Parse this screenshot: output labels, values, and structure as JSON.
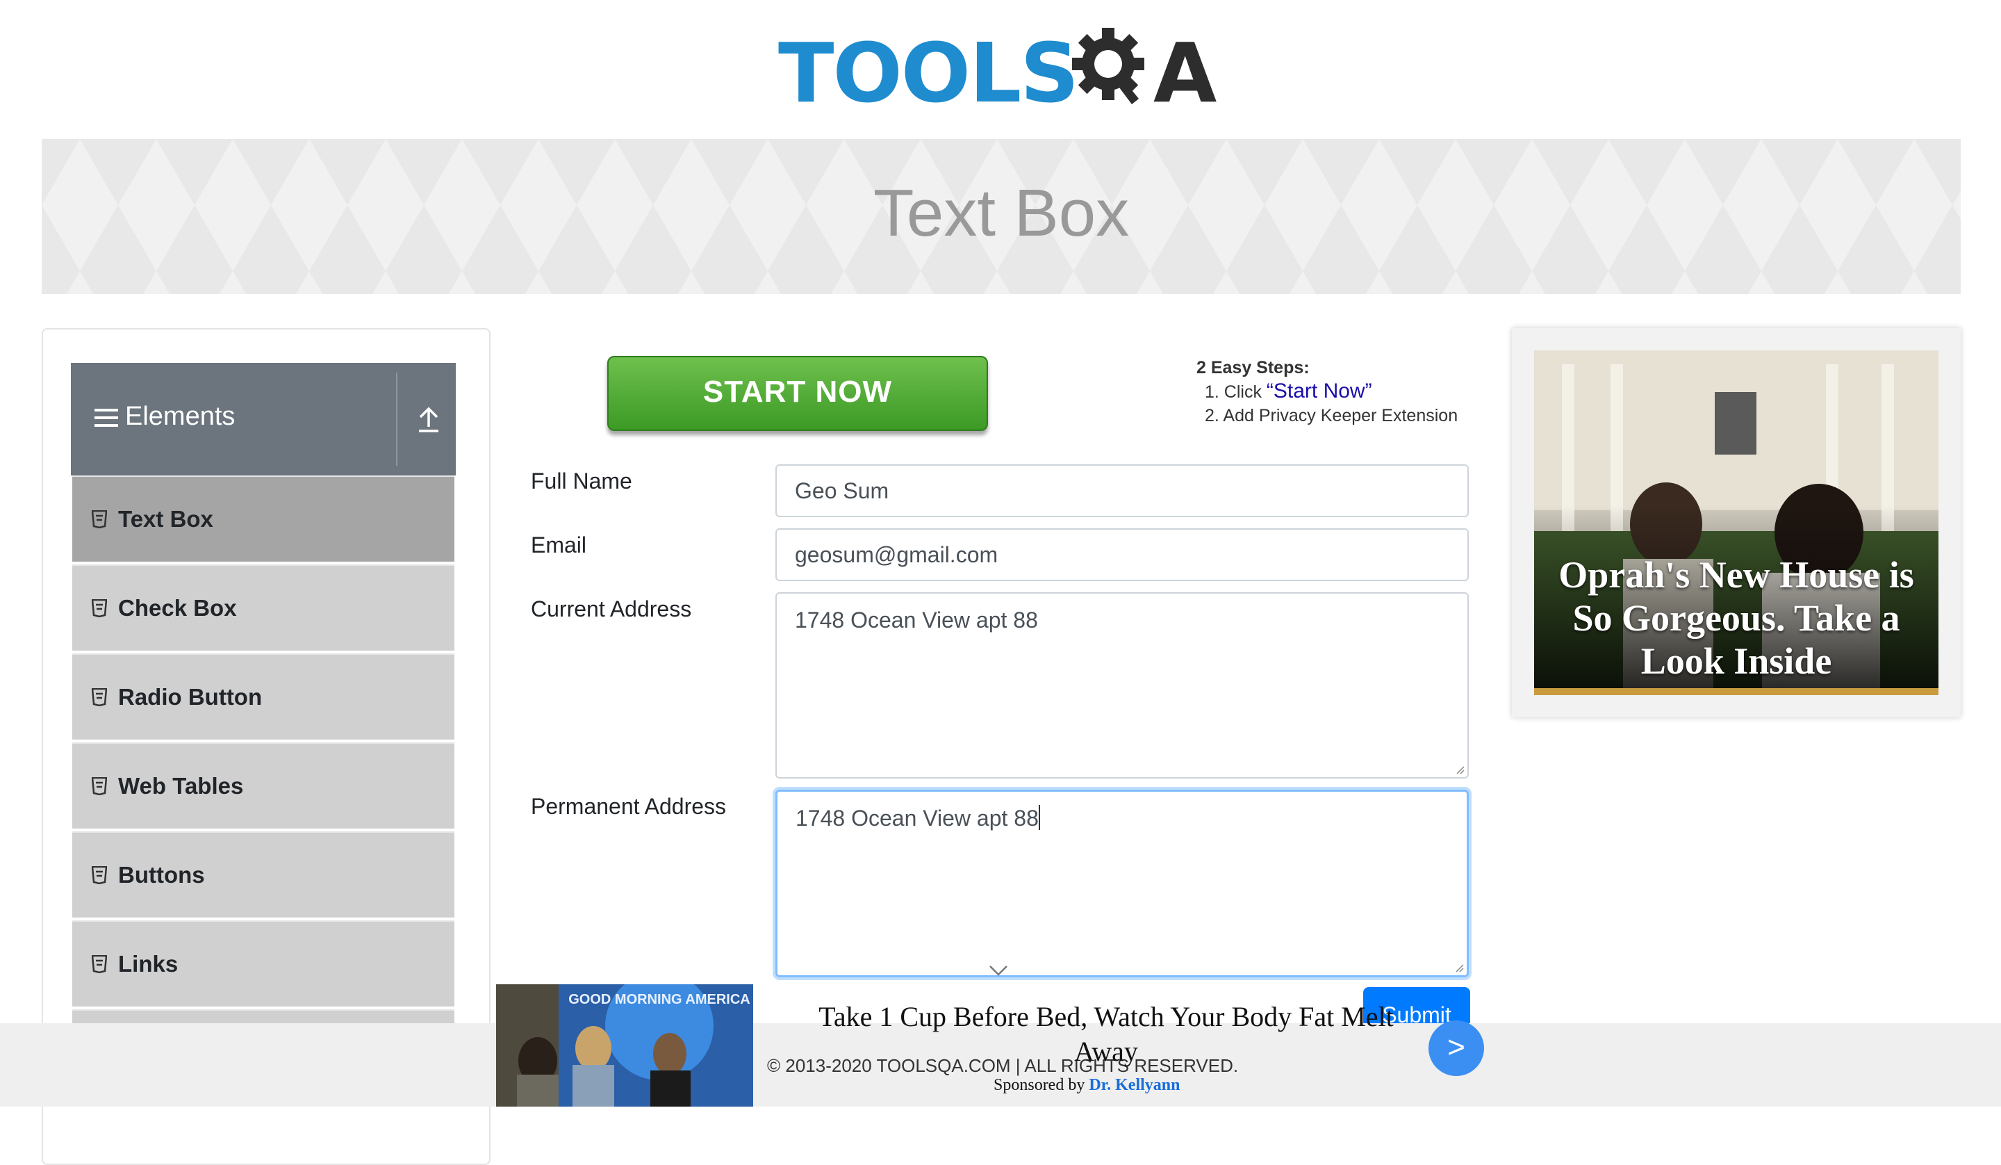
{
  "logo": {
    "text_tools": "TOOLS",
    "text_qa": "A"
  },
  "banner": {
    "title": "Text Box"
  },
  "sidebar": {
    "group_title": "Elements",
    "items": [
      {
        "label": "Text Box",
        "active": true
      },
      {
        "label": "Check Box"
      },
      {
        "label": "Radio Button"
      },
      {
        "label": "Web Tables"
      },
      {
        "label": "Buttons"
      },
      {
        "label": "Links"
      }
    ]
  },
  "promo": {
    "button_label": "START NOW",
    "steps_title": "2 Easy Steps:",
    "step1_prefix": "1. Click ",
    "step1_link": "“Start Now”",
    "step2": "2. Add Privacy Keeper Extension"
  },
  "form": {
    "full_name_label": "Full Name",
    "full_name_value": "Geo Sum",
    "email_label": "Email",
    "email_value": "geosum@gmail.com",
    "current_address_label": "Current Address",
    "current_address_value": "1748 Ocean View apt 88",
    "permanent_address_label": "Permanent Address",
    "permanent_address_value": "1748 Ocean View apt 88",
    "submit_label": "Submit"
  },
  "right_ad": {
    "headline": "Oprah's New House is So Gorgeous. Take a Look Inside"
  },
  "bottom_ad": {
    "image_text": "GOOD MORNING AMERICA",
    "headline": "Take 1 Cup Before Bed, Watch Your Body Fat Melt Away",
    "sponsor_prefix": "Sponsored by ",
    "sponsor_name": "Dr. Kellyann",
    "next_label": ">"
  },
  "footer": {
    "copyright": "© 2013-2020 TOOLSQA.COM | ALL RIGHTS RESERVED."
  },
  "colors": {
    "logo_blue": "#1f8ccf",
    "logo_dark": "#2d2d2d",
    "sidebar_header": "#6c757d",
    "menu_item": "#d0d0d0",
    "menu_active": "#a5a5a5",
    "submit_blue": "#007bff",
    "start_green": "#4caf30"
  }
}
